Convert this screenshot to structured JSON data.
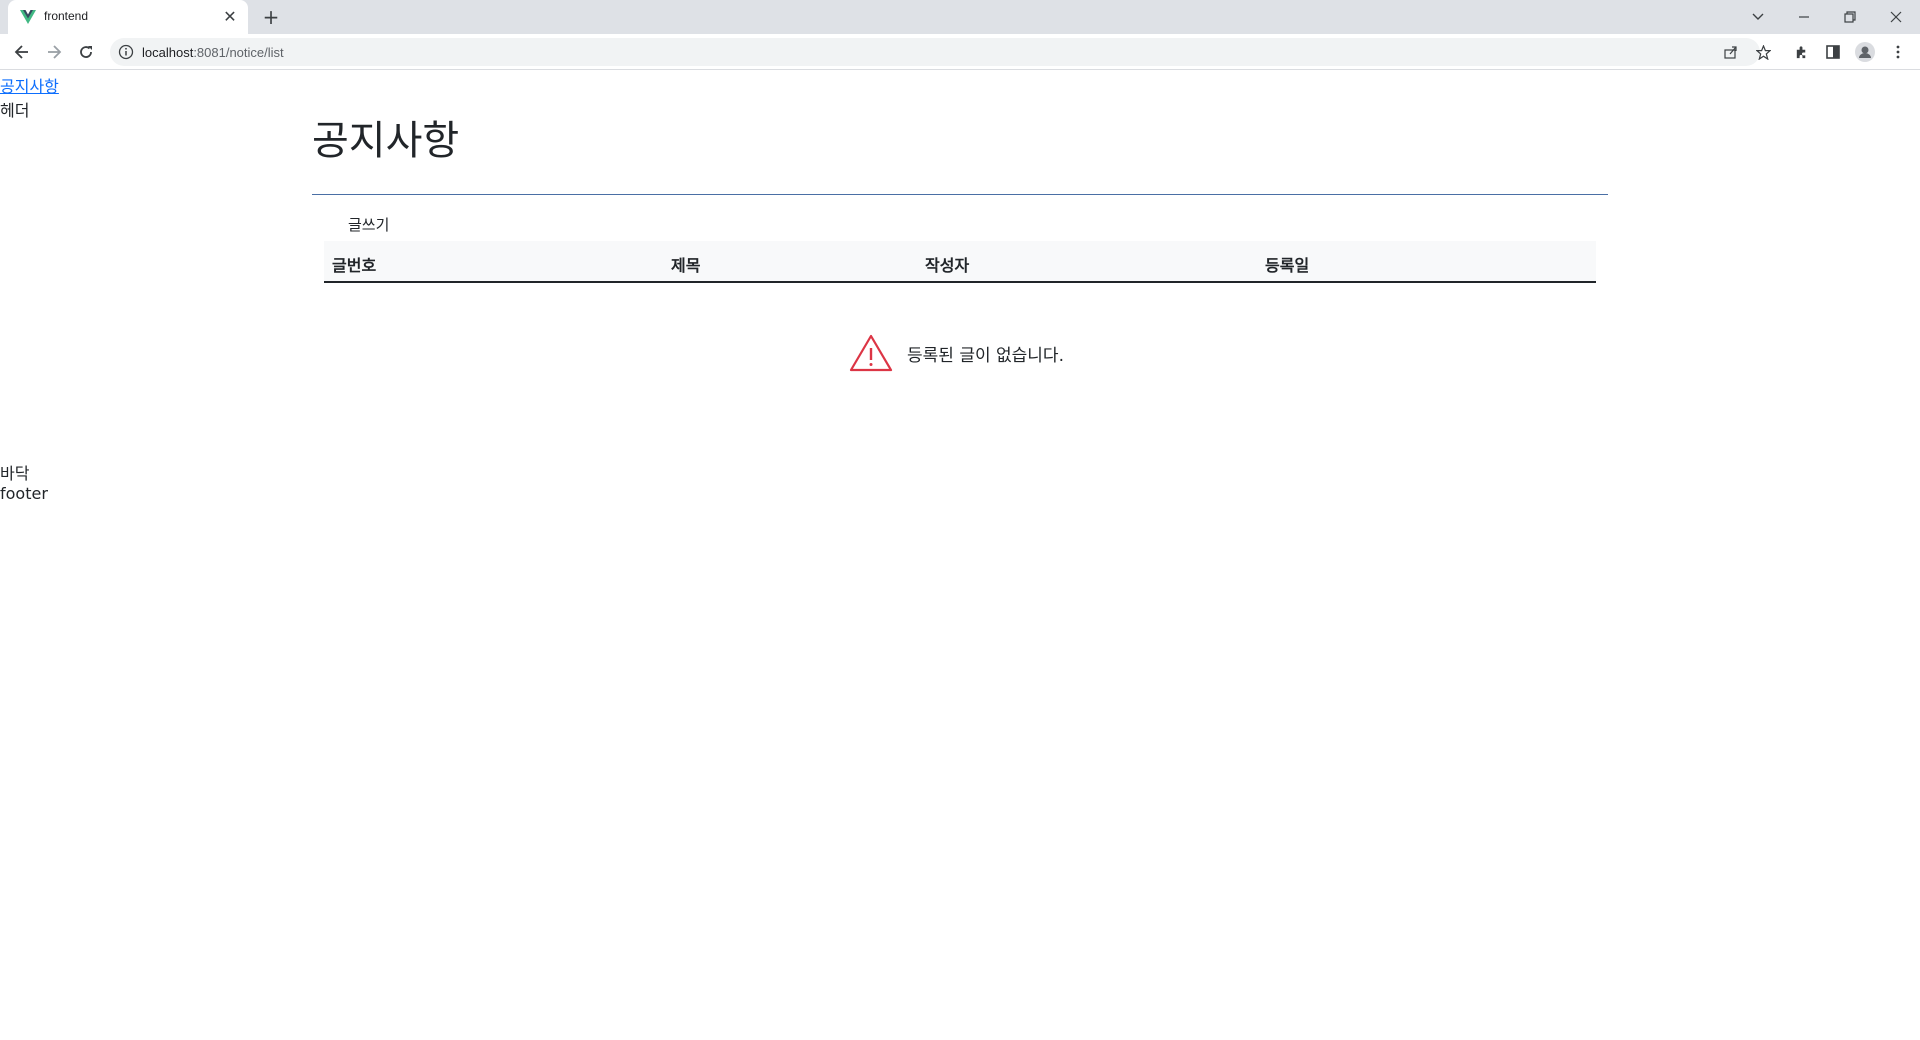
{
  "browser": {
    "tab_title": "frontend",
    "url_host": "localhost",
    "url_rest": ":8081/notice/list"
  },
  "page": {
    "nav_link": "공지사항",
    "header_text": "헤더",
    "title": "공지사항",
    "write_button": "글쓰기",
    "table": {
      "columns": [
        "글번호",
        "제목",
        "작성자",
        "등록일"
      ],
      "rows": []
    },
    "empty_message": "등록된 글이 없습니다.",
    "footer_ko": "바닥",
    "footer_en": "footer"
  },
  "colors": {
    "link": "#0d6efd",
    "title_rule": "#4a6fa5",
    "warning": "#dc3545"
  }
}
